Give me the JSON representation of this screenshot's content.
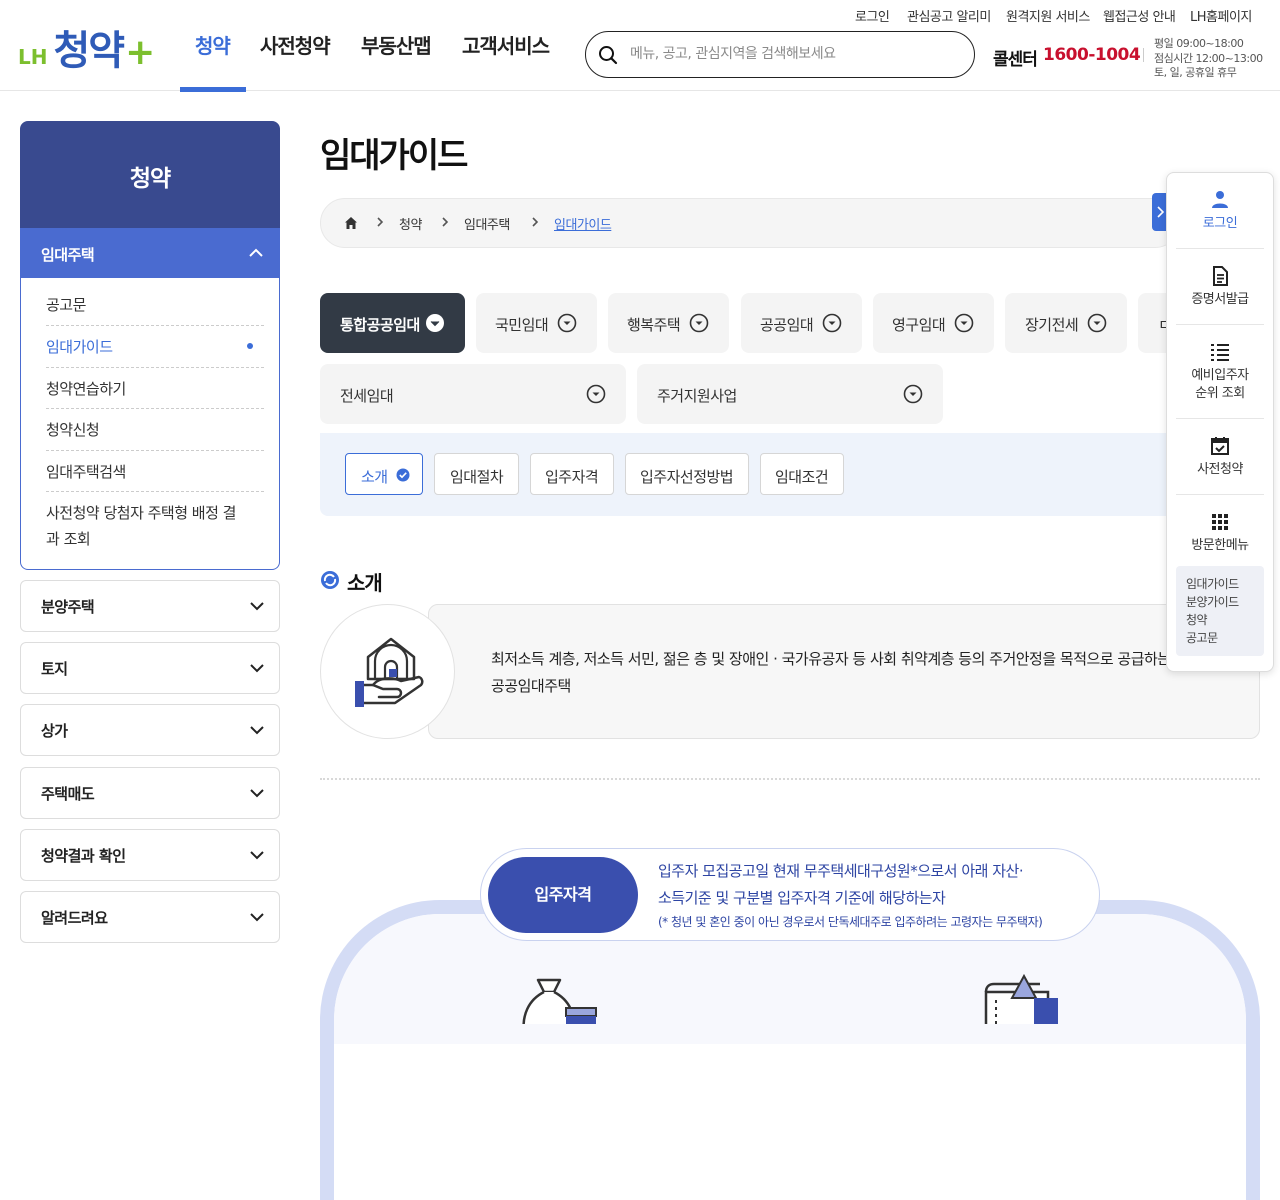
{
  "header": {
    "logo": {
      "prefix": "LH",
      "name": "청약",
      "plus": "+"
    },
    "gnb": [
      "청약",
      "사전청약",
      "부동산맵",
      "고객서비스"
    ],
    "utility_links": [
      "로그인",
      "관심공고 알리미",
      "원격지원 서비스",
      "웹접근성 안내",
      "LH홈페이지"
    ],
    "search_placeholder": "메뉴, 공고, 관심지역을 검색해보세요",
    "call_label": "콜센터",
    "call_number": "1600-1004",
    "hours": [
      "평일 09:00~18:00",
      "점심시간 12:00~13:00",
      "토, 일, 공휴일 휴무"
    ]
  },
  "sidebar": {
    "title": "청약",
    "open_section": "임대주택",
    "sub_items": [
      "공고문",
      "임대가이드",
      "청약연습하기",
      "청약신청",
      "임대주택검색",
      "사전청약 당첨자 주택형 배정 결",
      "과 조회"
    ],
    "sections": [
      "분양주택",
      "토지",
      "상가",
      "주택매도",
      "청약결과 확인",
      "알려드려요"
    ]
  },
  "page": {
    "title": "임대가이드",
    "breadcrumb": [
      "청약",
      "임대주택",
      "임대가이드"
    ]
  },
  "tabs": {
    "row1": [
      "통합공공임대",
      "국민임대",
      "행복주택",
      "공공임대",
      "영구임대",
      "장기전세",
      "ㅁ"
    ],
    "row2": [
      "전세임대",
      "주거지원사업"
    ]
  },
  "subtabs": [
    "소개",
    "임대절차",
    "입주자격",
    "입주자선정방법",
    "임대조건"
  ],
  "intro": {
    "section_title": "소개",
    "line1": "최저소득 계층, 저소득 서민, 젊은 층 및 장애인 · 국가유공자 등 사회 취약계층 등의 주거안정을 목적으로 공급하는",
    "line2": "공공임대주택"
  },
  "qualification": {
    "pill": "입주자격",
    "line1": "입주자 모집공고일 현재 무주택세대구성원*으로서 아래 자산·",
    "line2": "소득기준 및 구분별 입주자격 기준에 해당하는자",
    "note": "(* 청년 및 혼인 중이 아닌 경우로서 단독세대주로 입주하려는 고령자는 무주택자)"
  },
  "quick_panel": {
    "items": [
      "로그인",
      "증명서발급",
      "예비입주자",
      "순위 조회",
      "사전청약",
      "방문한메뉴"
    ],
    "recent": [
      "임대가이드",
      "분양가이드",
      "청약",
      "공고문"
    ]
  },
  "colors": {
    "brand_blue": "#3b6dd8",
    "nav_dark": "#394a8f",
    "call_red": "#c8102e",
    "logo_green": "#7cbf2e"
  }
}
